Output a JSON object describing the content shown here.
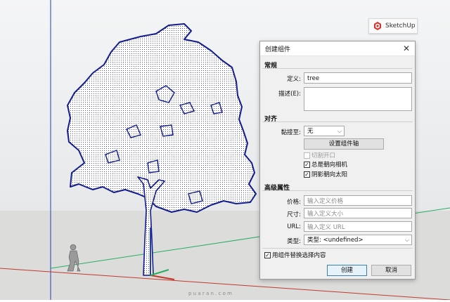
{
  "badge": {
    "label": "SketchUp",
    "icon": "sketchup-logo-icon"
  },
  "watermark": "p u a r a n . c o m",
  "dialog": {
    "title": "创建组件",
    "close_label": "✕",
    "general": {
      "heading": "常规",
      "definition_label": "定义:",
      "definition_value": "tree",
      "description_label": "描述(E):",
      "description_value": ""
    },
    "alignment": {
      "heading": "对齐",
      "glue_label": "黏接至:",
      "glue_value": "无",
      "set_axes_button": "设置组件轴",
      "cut_opening": {
        "label": "切割开口",
        "checked": false,
        "disabled": true
      },
      "face_camera": {
        "label": "总是朝向相机",
        "checked": true
      },
      "shadows_face_sun": {
        "label": "阴影朝向太阳",
        "checked": true
      }
    },
    "advanced": {
      "heading": "高级属性",
      "price_label": "价格:",
      "price_placeholder": "输入定义价格",
      "size_label": "尺寸:",
      "size_placeholder": "输入定义大小",
      "url_label": "URL:",
      "url_placeholder": "输入定义 URL",
      "type_label": "类型:",
      "type_value": "类型: <undefined>"
    },
    "replace_selection": {
      "label": "用组件替换选择内容",
      "checked": true
    },
    "create_button": "创建",
    "cancel_button": "取消"
  },
  "colors": {
    "axis_red": "#c0392b",
    "axis_green": "#27ae60",
    "axis_blue": "#1f3fbf",
    "tree_outline": "#141c8c",
    "sky": "#eef0f2",
    "ground": "#d9dad8"
  }
}
